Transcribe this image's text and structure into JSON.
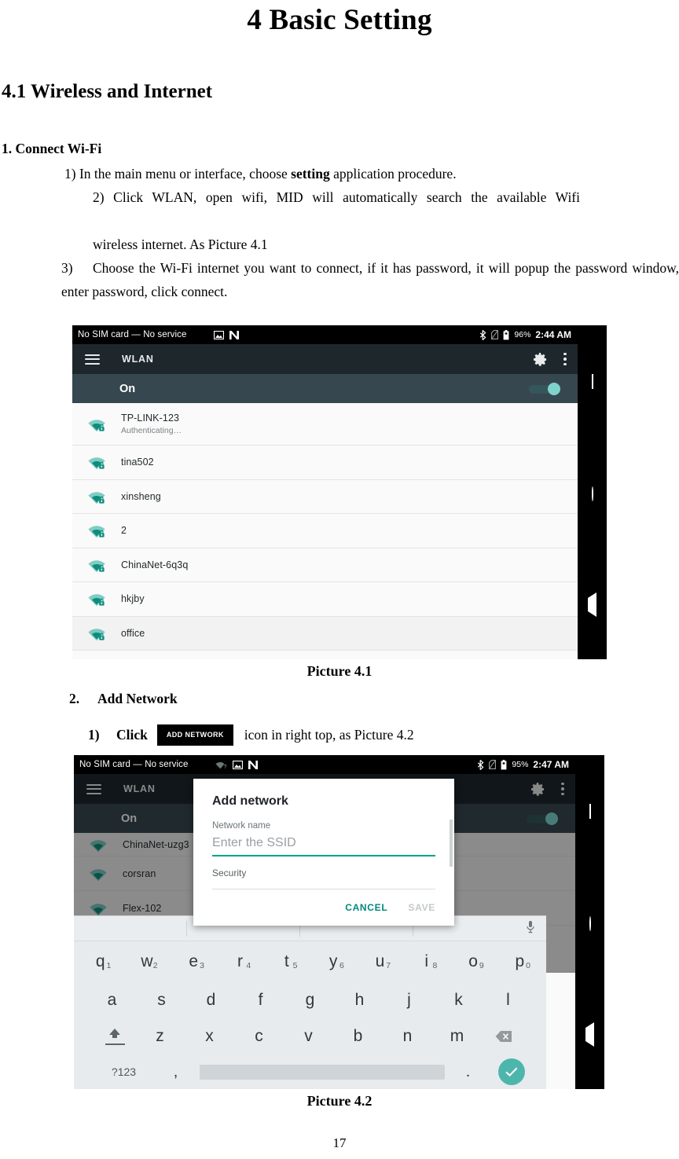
{
  "document": {
    "title": "4 Basic Setting",
    "section_heading": "4.1 Wireless and Internet",
    "subheading": "1. Connect Wi-Fi",
    "step1": "1) In the main menu or interface, choose ",
    "step1_bold": "setting",
    "step1_tail": " application procedure.",
    "step2_line1": "2) Click WLAN, open wifi, MID will automatically search the available Wifi",
    "step2_line2": "wireless internet. As Picture 4.1",
    "step3_num": "3)",
    "step3_text": "Choose the Wi-Fi internet you want to connect, if it has password, it will popup the password window, enter password, click connect.",
    "caption1": "Picture 4.1",
    "caption2": "Picture 4.2",
    "add_network_num": "2.",
    "add_network_title": "Add Network",
    "click_num": "1)",
    "click_label": "Click",
    "add_network_chip": "ADD NETWORK",
    "click_tail": "icon in right top, as Picture 4.2",
    "page_number": "17"
  },
  "picture41": {
    "statusbar": {
      "carrier": "No SIM card — No service",
      "battery_percent": "96%",
      "time": "2:44 AM",
      "icons": [
        "image-icon",
        "network-n-icon",
        "bluetooth-icon",
        "sim-off-icon",
        "battery-icon"
      ]
    },
    "toolbar": {
      "menu_icon": "hamburger-icon",
      "title": "WLAN",
      "settings_icon": "gear-icon",
      "overflow_icon": "kebab-menu-icon"
    },
    "wifi_switch": {
      "label": "On",
      "state": "on"
    },
    "networks": [
      {
        "name": "TP-LINK-123",
        "status": "Authenticating…",
        "secured": true
      },
      {
        "name": "tina502",
        "status": "",
        "secured": true
      },
      {
        "name": "xinsheng",
        "status": "",
        "secured": true
      },
      {
        "name": "2",
        "status": "",
        "secured": true
      },
      {
        "name": "ChinaNet-6q3q",
        "status": "",
        "secured": true
      },
      {
        "name": "hkjby",
        "status": "",
        "secured": true
      },
      {
        "name": "office",
        "status": "",
        "secured": true
      }
    ],
    "navbar": [
      "recents-square-icon",
      "home-circle-icon",
      "back-triangle-icon"
    ]
  },
  "picture42": {
    "statusbar": {
      "carrier": "No SIM card — No service",
      "battery_percent": "95%",
      "time": "2:47 AM",
      "icons": [
        "wifi-question-icon",
        "image-icon",
        "network-n-icon",
        "bluetooth-icon",
        "sim-off-icon",
        "battery-icon"
      ]
    },
    "toolbar": {
      "menu_icon": "hamburger-icon",
      "title": "WLAN",
      "settings_icon": "gear-icon",
      "overflow_icon": "kebab-menu-icon"
    },
    "wifi_switch": {
      "label": "On",
      "state": "on"
    },
    "background_networks": [
      {
        "name": "ChinaNet-uzg3"
      },
      {
        "name": "corsran"
      },
      {
        "name": "Flex-102"
      }
    ],
    "dialog": {
      "title": "Add network",
      "network_name_label": "Network name",
      "ssid_placeholder": "Enter the SSID",
      "security_label": "Security",
      "cancel_label": "CANCEL",
      "save_label": "SAVE"
    },
    "keyboard": {
      "row1": [
        {
          "key": "q",
          "num": "1"
        },
        {
          "key": "w",
          "num": "2"
        },
        {
          "key": "e",
          "num": "3"
        },
        {
          "key": "r",
          "num": "4"
        },
        {
          "key": "t",
          "num": "5"
        },
        {
          "key": "y",
          "num": "6"
        },
        {
          "key": "u",
          "num": "7"
        },
        {
          "key": "i",
          "num": "8"
        },
        {
          "key": "o",
          "num": "9"
        },
        {
          "key": "p",
          "num": "0"
        }
      ],
      "row2": [
        "a",
        "s",
        "d",
        "f",
        "g",
        "h",
        "j",
        "k",
        "l"
      ],
      "row3": [
        "z",
        "x",
        "c",
        "v",
        "b",
        "n",
        "m"
      ],
      "shift_icon": "shift-arrow-icon",
      "backspace_icon": "backspace-icon",
      "symbols_key": "?123",
      "comma_key": ",",
      "period_key": ".",
      "enter_icon": "check-enter-icon",
      "mic_icon": "microphone-icon"
    },
    "navbar": [
      "recents-square-icon",
      "home-circle-icon",
      "back-triangle-icon"
    ]
  },
  "colors": {
    "accent_teal": "#00897b",
    "toggle_teal": "#7fd3cd",
    "toolbar_dark": "#1d272c",
    "onrow_slate": "#37474f",
    "wifi_icon": "#12a08e"
  }
}
